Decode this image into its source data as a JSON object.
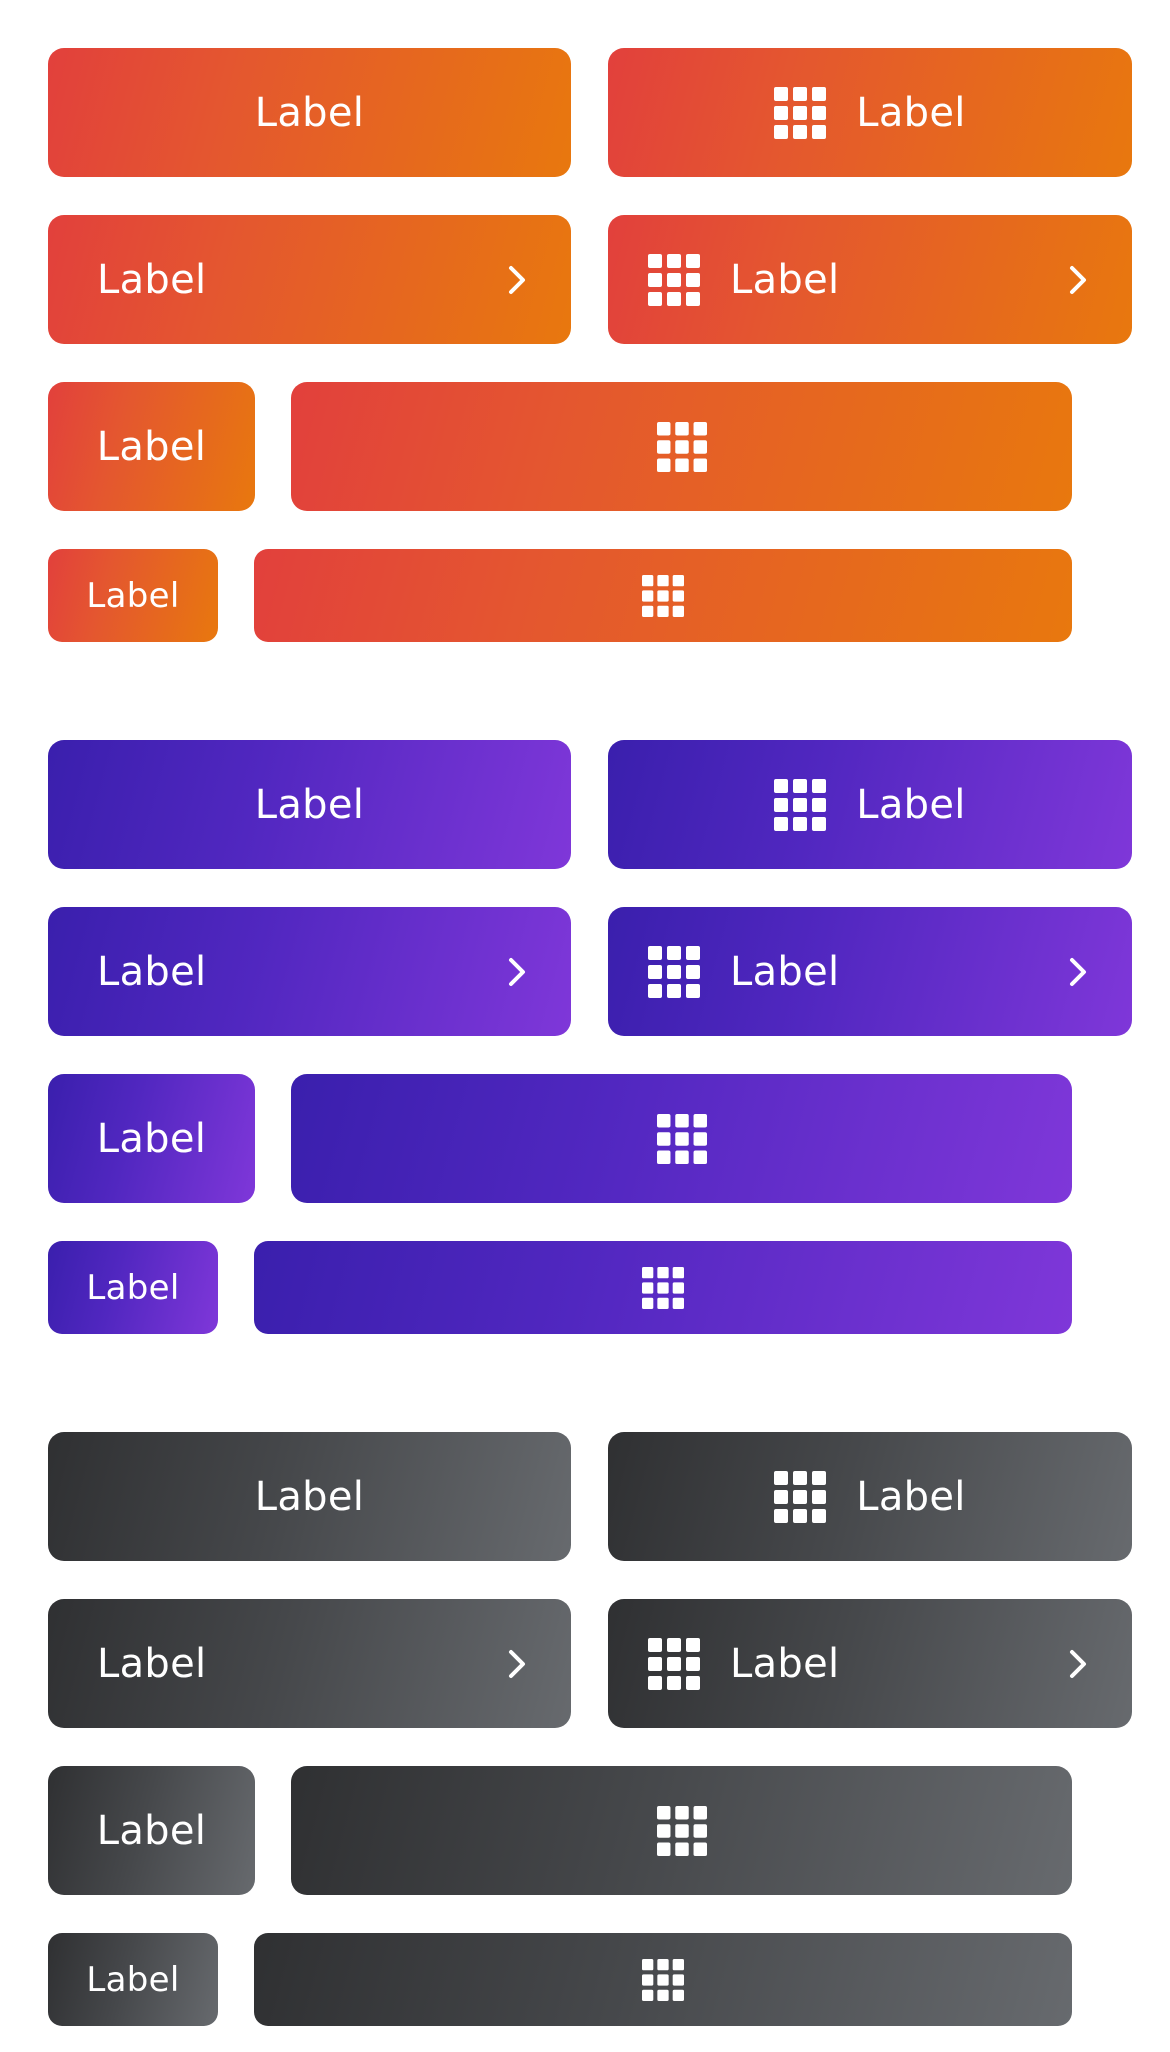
{
  "label": "Label",
  "icons": {
    "grid": "grid-icon",
    "chevron": "chevron-right-icon"
  },
  "groups": [
    {
      "name": "orange",
      "colors": [
        "#e2403c",
        "#e8780e"
      ]
    },
    {
      "name": "purple",
      "colors": [
        "#3a1fad",
        "#7f37d9"
      ]
    },
    {
      "name": "gray",
      "colors": [
        "#2f3032",
        "#676a6e"
      ]
    }
  ]
}
